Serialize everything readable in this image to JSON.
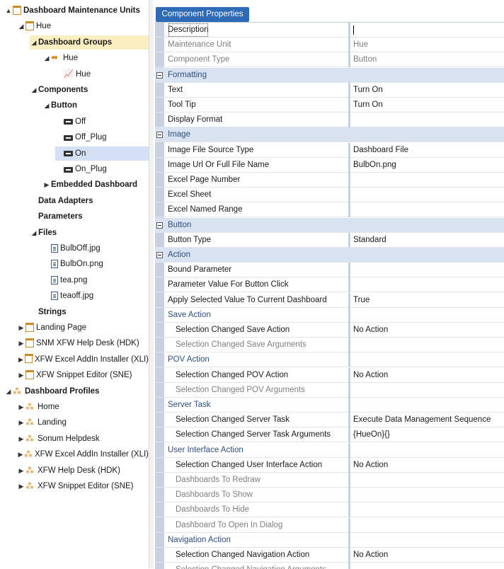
{
  "tree": {
    "nodes": [
      {
        "label": "Dashboard Maintenance Units",
        "indent": 0,
        "exp": "▲",
        "icon": "folder",
        "bold": true
      },
      {
        "label": "Hue",
        "indent": 1,
        "exp": "◢",
        "icon": "folder"
      },
      {
        "label": "Dashboard Groups",
        "indent": 2,
        "exp": "◢",
        "icon": "",
        "bold": true,
        "sel": "gold"
      },
      {
        "label": "Hue",
        "indent": 3,
        "exp": "◢",
        "icon": "dots"
      },
      {
        "label": "Hue",
        "indent": 4,
        "exp": "",
        "icon": "chart"
      },
      {
        "label": "Components",
        "indent": 2,
        "exp": "◢",
        "icon": "",
        "bold": true
      },
      {
        "label": "Button",
        "indent": 3,
        "exp": "◢",
        "icon": "",
        "bold": true
      },
      {
        "label": "Off",
        "indent": 4,
        "exp": "",
        "icon": "btn"
      },
      {
        "label": "Off_Plug",
        "indent": 4,
        "exp": "",
        "icon": "btn"
      },
      {
        "label": "On",
        "indent": 4,
        "exp": "",
        "icon": "btn",
        "sel": "blue"
      },
      {
        "label": "On_Plug",
        "indent": 4,
        "exp": "",
        "icon": "btn"
      },
      {
        "label": "Embedded Dashboard",
        "indent": 3,
        "exp": "▶",
        "icon": "",
        "bold": true
      },
      {
        "label": "Data Adapters",
        "indent": 2,
        "exp": "",
        "icon": "",
        "bold": true
      },
      {
        "label": "Parameters",
        "indent": 2,
        "exp": "",
        "icon": "",
        "bold": true
      },
      {
        "label": "Files",
        "indent": 2,
        "exp": "◢",
        "icon": "",
        "bold": true
      },
      {
        "label": "BulbOff.jpg",
        "indent": 3,
        "exp": "",
        "icon": "file"
      },
      {
        "label": "BulbOn.png",
        "indent": 3,
        "exp": "",
        "icon": "file"
      },
      {
        "label": "tea.png",
        "indent": 3,
        "exp": "",
        "icon": "file"
      },
      {
        "label": "teaoff.jpg",
        "indent": 3,
        "exp": "",
        "icon": "file"
      },
      {
        "label": "Strings",
        "indent": 2,
        "exp": "",
        "icon": "",
        "bold": true
      },
      {
        "label": "Landing Page",
        "indent": 1,
        "exp": "▶",
        "icon": "folder"
      },
      {
        "label": "SNM XFW Help Desk (HDK)",
        "indent": 1,
        "exp": "▶",
        "icon": "folder"
      },
      {
        "label": "XFW Excel AddIn Installer (XLI)",
        "indent": 1,
        "exp": "▶",
        "icon": "folder"
      },
      {
        "label": "XFW Snippet Editor (SNE)",
        "indent": 1,
        "exp": "▶",
        "icon": "folder"
      },
      {
        "label": "Dashboard Profiles",
        "indent": 0,
        "exp": "◢",
        "icon": "prof",
        "bold": true
      },
      {
        "label": "Home",
        "indent": 1,
        "exp": "▶",
        "icon": "prof"
      },
      {
        "label": "Landing",
        "indent": 1,
        "exp": "▶",
        "icon": "prof"
      },
      {
        "label": "Sonum Helpdesk",
        "indent": 1,
        "exp": "▶",
        "icon": "prof"
      },
      {
        "label": "XFW Excel AddIn Installer (XLI)",
        "indent": 1,
        "exp": "▶",
        "icon": "prof"
      },
      {
        "label": "XFW Help Desk (HDK)",
        "indent": 1,
        "exp": "▶",
        "icon": "prof"
      },
      {
        "label": "XFW Snippet Editor (SNE)",
        "indent": 1,
        "exp": "▶",
        "icon": "prof"
      }
    ]
  },
  "tab": {
    "label": "Component Properties"
  },
  "properties": [
    {
      "kind": "row",
      "name": "Description",
      "value": "",
      "focus": true
    },
    {
      "kind": "row",
      "name": "Maintenance Unit",
      "value": "Hue",
      "dim": true
    },
    {
      "kind": "row",
      "name": "Component Type",
      "value": "Button",
      "dim": true
    },
    {
      "kind": "cat",
      "name": "Formatting"
    },
    {
      "kind": "row",
      "name": "Text",
      "value": "Turn On"
    },
    {
      "kind": "row",
      "name": "Tool Tip",
      "value": "Turn On"
    },
    {
      "kind": "row",
      "name": "Display Format",
      "value": ""
    },
    {
      "kind": "cat",
      "name": "Image"
    },
    {
      "kind": "row",
      "name": "Image File Source Type",
      "value": "Dashboard File"
    },
    {
      "kind": "row",
      "name": "Image Url Or Full File Name",
      "value": "BulbOn.png"
    },
    {
      "kind": "row",
      "name": "Excel Page Number",
      "value": ""
    },
    {
      "kind": "row",
      "name": "Excel Sheet",
      "value": ""
    },
    {
      "kind": "row",
      "name": "Excel Named Range",
      "value": ""
    },
    {
      "kind": "cat",
      "name": "Button"
    },
    {
      "kind": "row",
      "name": "Button Type",
      "value": "Standard"
    },
    {
      "kind": "cat",
      "name": "Action"
    },
    {
      "kind": "row",
      "name": "Bound Parameter",
      "value": ""
    },
    {
      "kind": "row",
      "name": "Parameter Value For Button Click",
      "value": ""
    },
    {
      "kind": "row",
      "name": "Apply Selected Value To Current Dashboard",
      "value": "True"
    },
    {
      "kind": "sub",
      "name": "Save Action"
    },
    {
      "kind": "row",
      "name": "Selection Changed Save Action",
      "value": "No Action",
      "ind": true
    },
    {
      "kind": "row",
      "name": "Selection Changed Save Arguments",
      "value": "",
      "ind": true,
      "dim": true
    },
    {
      "kind": "sub",
      "name": "POV Action"
    },
    {
      "kind": "row",
      "name": "Selection Changed POV Action",
      "value": "No Action",
      "ind": true
    },
    {
      "kind": "row",
      "name": "Selection Changed POV Arguments",
      "value": "",
      "ind": true,
      "dim": true
    },
    {
      "kind": "sub",
      "name": "Server Task"
    },
    {
      "kind": "row",
      "name": "Selection Changed Server Task",
      "value": "Execute Data Management Sequence",
      "ind": true
    },
    {
      "kind": "row",
      "name": "Selection Changed Server Task Arguments",
      "value": "{HueOn}{}",
      "ind": true
    },
    {
      "kind": "sub",
      "name": "User Interface Action"
    },
    {
      "kind": "row",
      "name": "Selection Changed User Interface Action",
      "value": "No Action",
      "ind": true
    },
    {
      "kind": "row",
      "name": "Dashboards To Redraw",
      "value": "",
      "ind": true,
      "dim": true
    },
    {
      "kind": "row",
      "name": "Dashboards To Show",
      "value": "",
      "ind": true,
      "dim": true
    },
    {
      "kind": "row",
      "name": "Dashboards To Hide",
      "value": "",
      "ind": true,
      "dim": true
    },
    {
      "kind": "row",
      "name": "Dashboard To Open In Dialog",
      "value": "",
      "ind": true,
      "dim": true
    },
    {
      "kind": "sub",
      "name": "Navigation Action"
    },
    {
      "kind": "row",
      "name": "Selection Changed Navigation Action",
      "value": "No Action",
      "ind": true
    },
    {
      "kind": "row",
      "name": "Selection Changed Navigation Arguments",
      "value": "",
      "ind": true,
      "dim": true
    }
  ]
}
